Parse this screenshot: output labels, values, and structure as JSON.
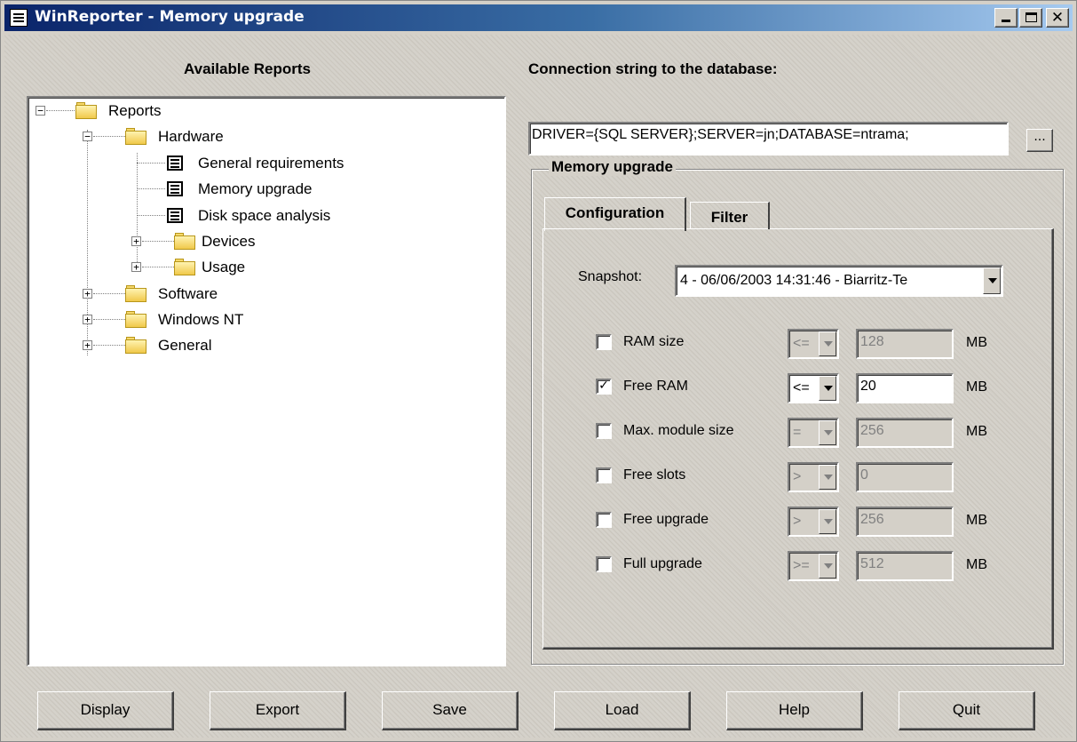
{
  "window": {
    "title": "WinReporter - Memory upgrade"
  },
  "left": {
    "heading": "Available Reports",
    "tree": {
      "root": "Reports",
      "hardware": "Hardware",
      "general_requirements": "General requirements",
      "memory_upgrade": "Memory upgrade",
      "disk_space_analysis": "Disk space analysis",
      "devices": "Devices",
      "usage": "Usage",
      "software": "Software",
      "windows_nt": "Windows NT",
      "general": "General"
    }
  },
  "right": {
    "conn_heading": "Connection string to the database:",
    "conn_value": "DRIVER={SQL SERVER};SERVER=jn;DATABASE=ntrama;",
    "browse_label": "...",
    "group_title": "Memory upgrade",
    "tabs": {
      "configuration": "Configuration",
      "filter": "Filter"
    },
    "snapshot": {
      "label": "Snapshot:",
      "value": "4 - 06/06/2003 14:31:46 - Biarritz-Te"
    },
    "filters": [
      {
        "label": "RAM size",
        "checked": false,
        "op": "<=",
        "value": "128",
        "unit": "MB"
      },
      {
        "label": "Free RAM",
        "checked": true,
        "op": "<=",
        "value": "20",
        "unit": "MB"
      },
      {
        "label": "Max. module size",
        "checked": false,
        "op": "=",
        "value": "256",
        "unit": "MB"
      },
      {
        "label": "Free slots",
        "checked": false,
        "op": ">",
        "value": "0",
        "unit": ""
      },
      {
        "label": "Free upgrade",
        "checked": false,
        "op": ">",
        "value": "256",
        "unit": "MB"
      },
      {
        "label": "Full upgrade",
        "checked": false,
        "op": ">=",
        "value": "512",
        "unit": "MB"
      }
    ]
  },
  "buttons": {
    "display": "Display",
    "export": "Export",
    "save": "Save",
    "load": "Load",
    "help": "Help",
    "quit": "Quit"
  }
}
